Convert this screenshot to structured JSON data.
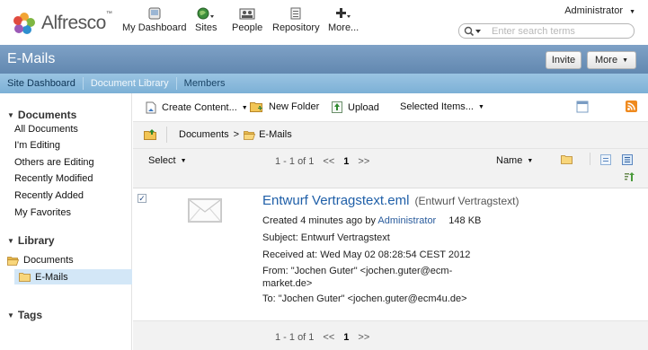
{
  "header": {
    "logo_text": "Alfresco",
    "logo_tm": "™",
    "nav": [
      {
        "label": "My Dashboard",
        "icon": "dashboard-icon"
      },
      {
        "label": "Sites",
        "icon": "sites-globe-icon"
      },
      {
        "label": "People",
        "icon": "people-icon"
      },
      {
        "label": "Repository",
        "icon": "repository-icon"
      },
      {
        "label": "More...",
        "icon": "more-plus-icon"
      }
    ],
    "user": "Administrator",
    "search_placeholder": "Enter search terms"
  },
  "site": {
    "title": "E-Mails",
    "invite_label": "Invite",
    "more_label": "More",
    "nav": [
      "Site Dashboard",
      "Document Library",
      "Members"
    ]
  },
  "left": {
    "documents_heading": "Documents",
    "filters": [
      "All Documents",
      "I'm Editing",
      "Others are Editing",
      "Recently Modified",
      "Recently Added",
      "My Favorites"
    ],
    "library_heading": "Library",
    "tree": [
      "Documents",
      "E-Mails"
    ],
    "tags_heading": "Tags"
  },
  "toolbar": {
    "create_label": "Create Content...",
    "new_folder_label": "New Folder",
    "upload_label": "Upload",
    "selected_label": "Selected Items..."
  },
  "breadcrumb": {
    "root": "Documents",
    "sep": ">",
    "current": "E-Mails"
  },
  "list": {
    "select_label": "Select",
    "sort_label": "Name",
    "pager": {
      "range": "1 - 1 of 1",
      "prev": "<<",
      "page": "1",
      "next": ">>"
    }
  },
  "item": {
    "name": "Entwurf Vertragstext.eml",
    "title": "(Entwurf Vertragstext)",
    "created_prefix": "Created 4 minutes ago by",
    "created_by": "Administrator",
    "size": "148 KB",
    "subject": "Subject: Entwurf Vertragstext",
    "received": "Received at: Wed May 02 08:28:54 CEST 2012",
    "from": "From: \"Jochen Guter\" <jochen.guter@ecm-market.de>",
    "to": "To: \"Jochen Guter\" <jochen.guter@ecm4u.de>"
  },
  "colors": {
    "title_bar": "#6a8db3",
    "site_nav": "#83b5d9",
    "link": "#1f5fa8"
  }
}
